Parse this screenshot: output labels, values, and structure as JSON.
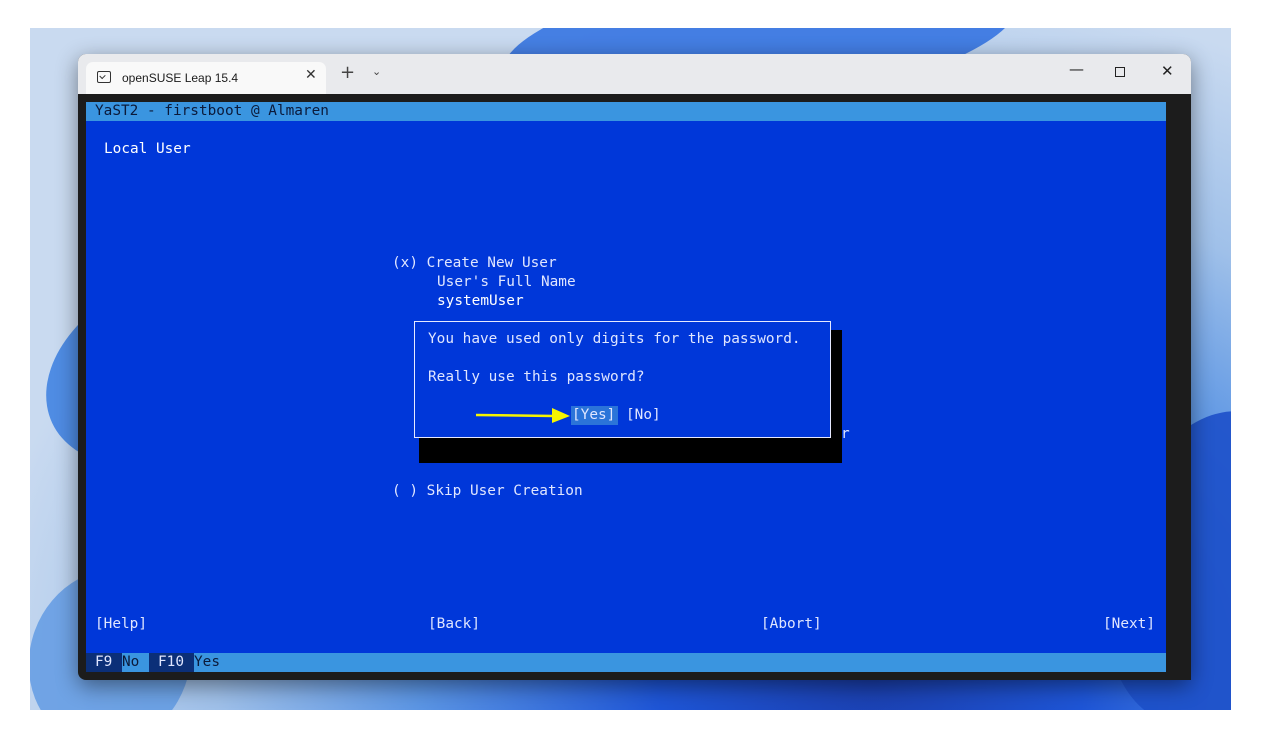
{
  "window": {
    "tab_title": "openSUSE Leap 15.4",
    "tab_close": "✕",
    "new_tab": "+",
    "tab_dropdown": "⌄",
    "minimize": "—",
    "close": "✕"
  },
  "terminal": {
    "header": "YaST2 - firstboot @ Almaren",
    "screen_title": "Local User",
    "create_option": "(x) Create New User",
    "full_name_label": "User's Full Name",
    "full_name_value": "systemUser",
    "partial_char": "r",
    "skip_option": "( ) Skip User Creation",
    "buttons": {
      "help": "[Help]",
      "back": "[Back]",
      "abort": "[Abort]",
      "next": "[Next]"
    },
    "dialog": {
      "message": "You have used only digits for the password.",
      "question": "Really use this password?",
      "yes": "[Yes]",
      "no": "[No]"
    },
    "status": {
      "f9_key": "F9",
      "f9_label": "No",
      "f10_key": "F10",
      "f10_label": "Yes"
    }
  },
  "colors": {
    "terminal_bg": "#0037d9",
    "header_bar": "#3a95e0",
    "annotation_arrow": "#f5f500"
  }
}
